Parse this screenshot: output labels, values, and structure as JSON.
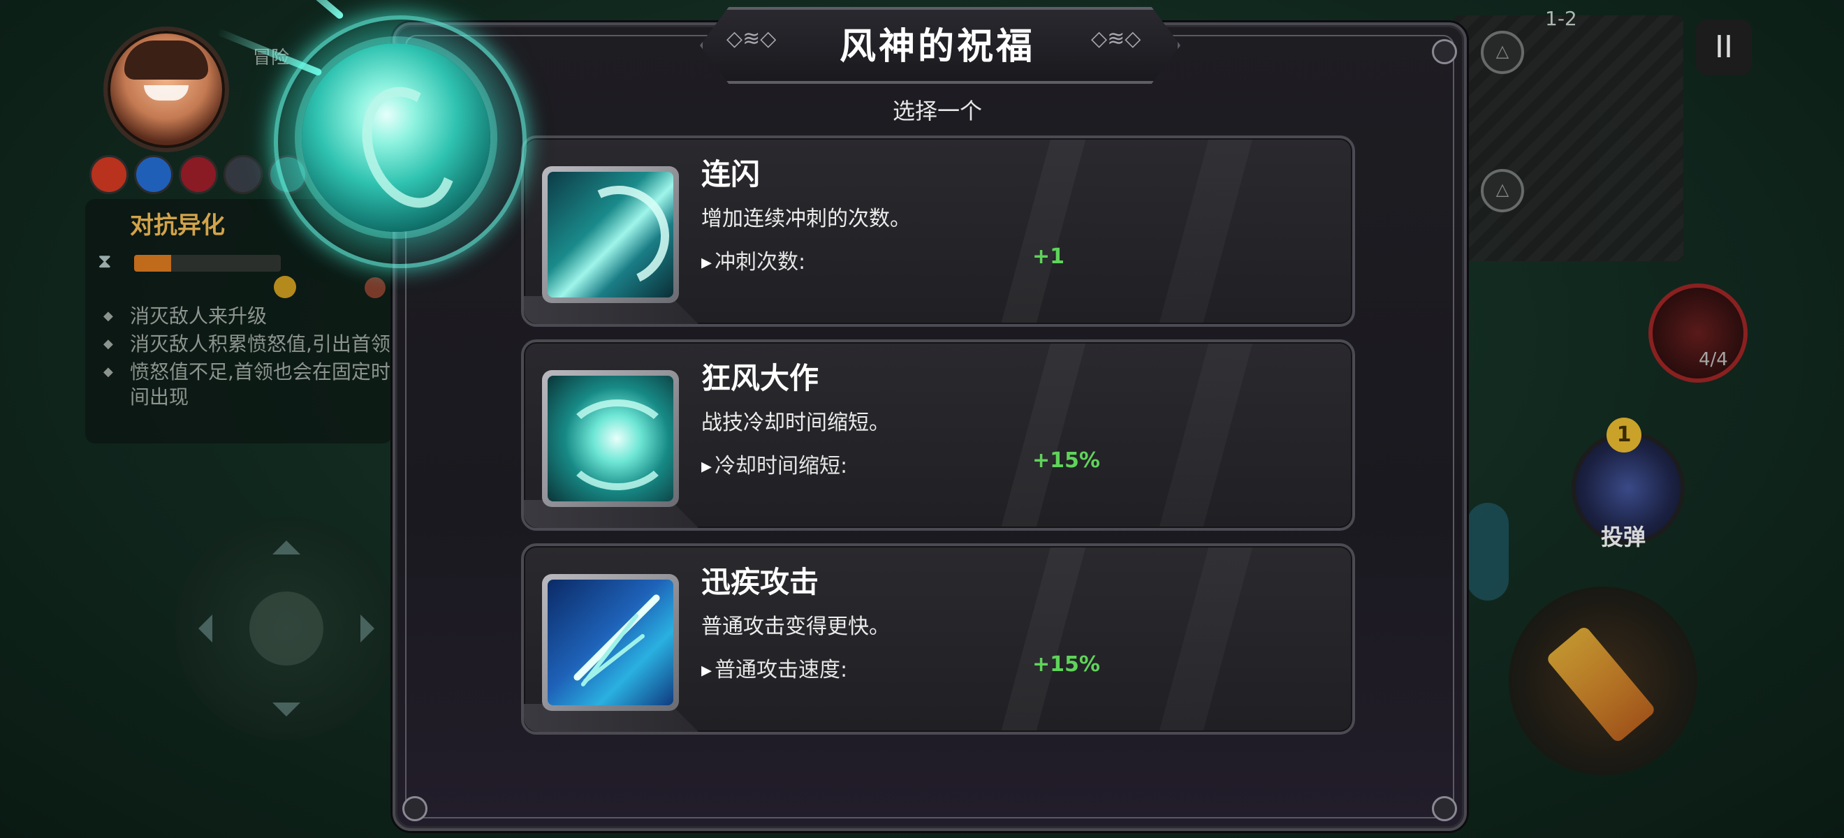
{
  "hud": {
    "adventure_label": "冒险",
    "minimap_level": "1-2",
    "pause_symbol": "II",
    "potion_count": "4/4",
    "bomb_level": "1",
    "bomb_label": "投弹"
  },
  "mission": {
    "title": "对抗异化",
    "progress": 0.25,
    "items": [
      "消灭敌人来升级",
      "消灭敌人积累愤怒值,引出首领",
      "愤怒值不足,首领也会在固定时间出现"
    ]
  },
  "modal": {
    "title": "风神的祝福",
    "subtitle": "选择一个",
    "cards": [
      {
        "name": "连闪",
        "desc": "增加连续冲刺的次数。",
        "stat": "冲刺次数:",
        "value": "+1",
        "icon": "dash-icon"
      },
      {
        "name": "狂风大作",
        "desc": "战技冷却时间缩短。",
        "stat": "冷却时间缩短:",
        "value": "+15%",
        "icon": "whirlwind-icon"
      },
      {
        "name": "迅疾攻击",
        "desc": "普通攻击变得更快。",
        "stat": "普通攻击速度:",
        "value": "+15%",
        "icon": "swift-strike-icon"
      }
    ]
  },
  "colors": {
    "accent_teal": "#2fc2b0",
    "value_green": "#5fd45a",
    "mission_title": "#d2a34a"
  }
}
